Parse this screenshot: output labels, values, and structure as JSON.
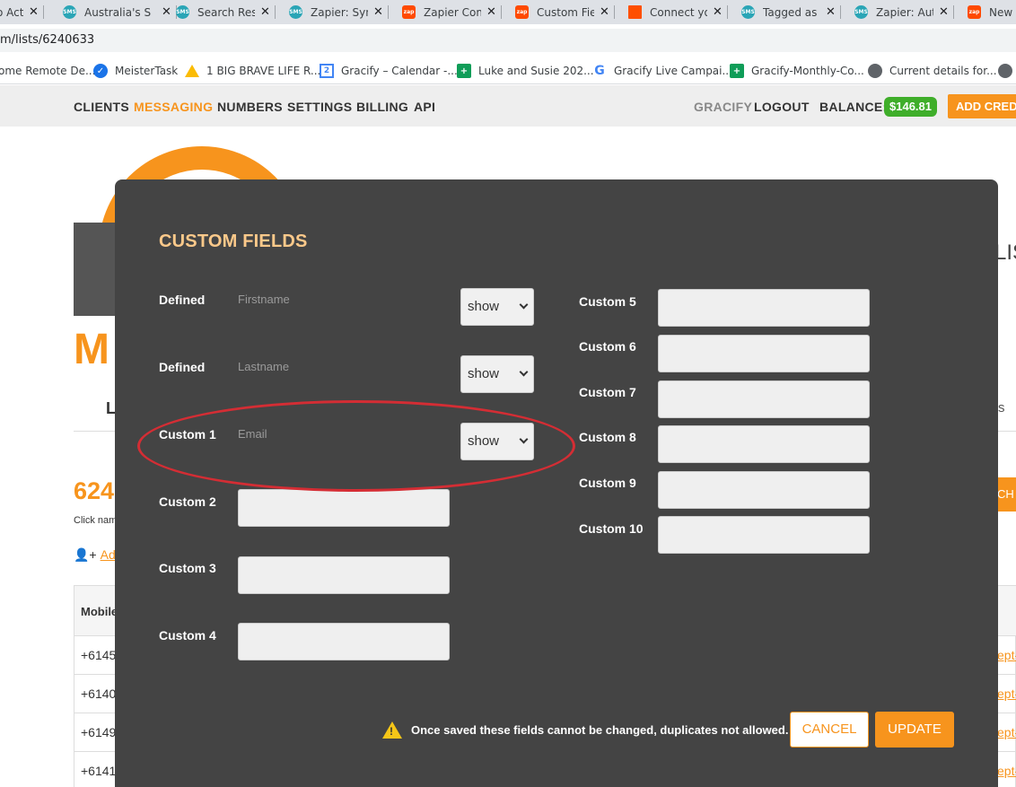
{
  "browser": {
    "tabs": [
      {
        "title": "o Act",
        "icon": "zap"
      },
      {
        "title": "Australia's S",
        "icon": "sms"
      },
      {
        "title": "Search Resu",
        "icon": "sms"
      },
      {
        "title": "Zapier: Sync",
        "icon": "sms"
      },
      {
        "title": "Zapier Com",
        "icon": "zap"
      },
      {
        "title": "Custom Fiel",
        "icon": "zap"
      },
      {
        "title": "Connect yo",
        "icon": "red"
      },
      {
        "title": "Tagged as C",
        "icon": "sms"
      },
      {
        "title": "Zapier: Auto",
        "icon": "sms"
      },
      {
        "title": "New C",
        "icon": "zap"
      }
    ],
    "address": "m/lists/6240633",
    "bookmarks": [
      {
        "label": "ome Remote De...",
        "icon": "none"
      },
      {
        "label": "MeisterTask",
        "icon": "mt"
      },
      {
        "label": "1 BIG BRAVE LIFE R...",
        "icon": "drive"
      },
      {
        "label": "Gracify – Calendar -...",
        "icon": "cal"
      },
      {
        "label": "Luke and Susie 202...",
        "icon": "sheet"
      },
      {
        "label": "Gracify Live Campai...",
        "icon": "goog"
      },
      {
        "label": "Gracify-Monthly-Co...",
        "icon": "sheet"
      },
      {
        "label": "Current details for...",
        "icon": "globe"
      }
    ]
  },
  "nav": {
    "clients": "CLIENTS",
    "messaging": "MESSAGING",
    "numbers": "NUMBERS",
    "settings": "SETTINGS",
    "billing": "BILLING",
    "api": "API",
    "account": "GRACIFY",
    "logout": "LOGOUT",
    "balance_label": "BALANCE:",
    "balance_value": "$146.81",
    "add_credit": "ADD CRED"
  },
  "background": {
    "list_heading_fragment": "LIS",
    "list_id_fragment": "624",
    "click_name_fragment": "Click nam",
    "add_fragment": "Add",
    "search_btn_fragment": "CH",
    "table_header": "Mobile",
    "rows": [
      "+6145",
      "+6140",
      "+6149",
      "+6141"
    ],
    "row_links": [
      "ept-",
      "ept-",
      "ept-",
      "ept-"
    ]
  },
  "modal": {
    "title": "CUSTOM FIELDS",
    "left_fields": [
      {
        "label": "Defined",
        "value": "Firstname",
        "select": "show"
      },
      {
        "label": "Defined",
        "value": "Lastname",
        "select": "show"
      },
      {
        "label": "Custom 1",
        "value": "Email",
        "select": "show"
      },
      {
        "label": "Custom 2",
        "value": ""
      },
      {
        "label": "Custom 3",
        "value": ""
      },
      {
        "label": "Custom 4",
        "value": ""
      }
    ],
    "right_fields": [
      {
        "label": "Custom 5",
        "value": ""
      },
      {
        "label": "Custom 6",
        "value": ""
      },
      {
        "label": "Custom 7",
        "value": ""
      },
      {
        "label": "Custom 8",
        "value": ""
      },
      {
        "label": "Custom 9",
        "value": ""
      },
      {
        "label": "Custom 10",
        "value": ""
      }
    ],
    "warning": "Once saved these fields cannot be changed, duplicates not allowed.",
    "cancel": "CANCEL",
    "update": "UPDATE"
  },
  "colors": {
    "accent": "#f7941d",
    "modal_bg": "#444444",
    "balance_badge": "#3fae2a",
    "annotation": "#d42d34",
    "title": "#fcc98a"
  }
}
